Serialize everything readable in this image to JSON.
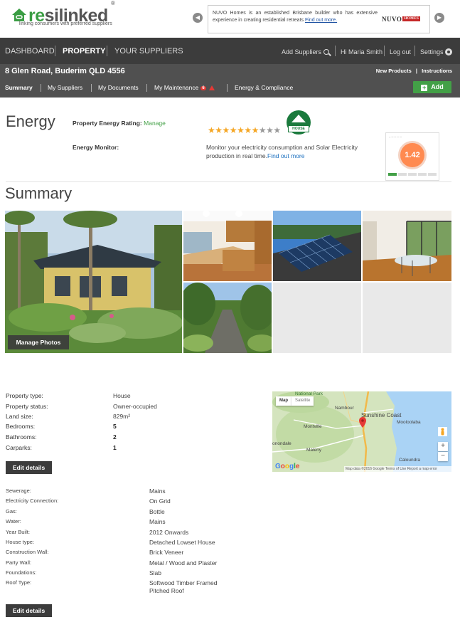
{
  "brand": {
    "name_prefix": "re",
    "name_suffix": "silinked",
    "registered": "®",
    "tagline": "linking consumers with preferred suppliers"
  },
  "ad": {
    "text": "NUVO Homes is an established Brisbane builder who has extensive experience in creating residential retreats",
    "link": "Find out more.",
    "logo_text": "NUVO",
    "logo_tag": "HOMES"
  },
  "topnav": {
    "dashboard": "DASHBOARD",
    "property": "PROPERTY",
    "suppliers": "YOUR SUPPLIERS",
    "add_suppliers": "Add Suppliers",
    "greeting": "Hi Maria Smith",
    "logout": "Log out",
    "settings": "Settings"
  },
  "property": {
    "address": "8 Glen Road, Buderim QLD 4556",
    "new_products": "New Products",
    "instructions": "Instructions"
  },
  "subnav": {
    "summary": "Summary",
    "my_suppliers": "My Suppliers",
    "my_documents": "My Documents",
    "my_maintenance": "My Maintenance",
    "maintenance_count": "6",
    "energy": "Energy & Compliance",
    "add": "Add"
  },
  "energy": {
    "title": "Energy",
    "rating_label": "Property Energy Rating:",
    "rating_manage": "Manage",
    "stars_filled": 7,
    "stars_total": 10,
    "badge_text": "HOUSE",
    "monitor_label": "Energy Monitor:",
    "monitor_text": "Monitor your electricity consumption and Solar Electricity production in real time.",
    "monitor_link": "Find out more",
    "gauge_value": "1.42"
  },
  "summary": {
    "title": "Summary",
    "manage_photos": "Manage Photos"
  },
  "details": {
    "rows": [
      {
        "label": "Property type:",
        "value": "House"
      },
      {
        "label": "Property status:",
        "value": "Owner-occupied"
      },
      {
        "label": "Land size:",
        "value": "829m²"
      },
      {
        "label": "Bedrooms:",
        "value": "5"
      },
      {
        "label": "Bathrooms:",
        "value": "2"
      },
      {
        "label": "Carparks:",
        "value": "1"
      }
    ],
    "edit": "Edit details"
  },
  "construction": {
    "rows": [
      {
        "label": "Sewerage:",
        "value": "Mains"
      },
      {
        "label": "Electricity Connection:",
        "value": "On Grid"
      },
      {
        "label": "Gas:",
        "value": "Bottle"
      },
      {
        "label": "Water:",
        "value": "Mains"
      },
      {
        "label": "Year Built:",
        "value": "2012 Onwards"
      },
      {
        "label": "House type:",
        "value": "Detached Lowset House"
      },
      {
        "label": "Construction Wall:",
        "value": "Brick Veneer"
      },
      {
        "label": "Party Wall:",
        "value": "Metal / Wood and Plaster"
      },
      {
        "label": "Foundations:",
        "value": "Slab"
      },
      {
        "label": "Roof Type:",
        "value": "Softwood Timber Framed",
        "value2": "Pitched Roof"
      }
    ],
    "edit": "Edit details"
  },
  "map": {
    "tab_map": "Map",
    "tab_satellite": "Satellite",
    "places": [
      "National Park",
      "Nambour",
      "Sunshine Coast",
      "Mooloolaba",
      "Montville",
      "Maleny",
      "Caloundra",
      "onondale"
    ],
    "google": "Google",
    "footer": "Map data ©2016 Google   Terms of Use   Report a map error"
  },
  "colors": {
    "brand_green": "#3a9d43",
    "nav_dark": "#3c3c3c",
    "bar_gray": "#505050",
    "add_green": "#43a047",
    "star": "#f5a623"
  }
}
